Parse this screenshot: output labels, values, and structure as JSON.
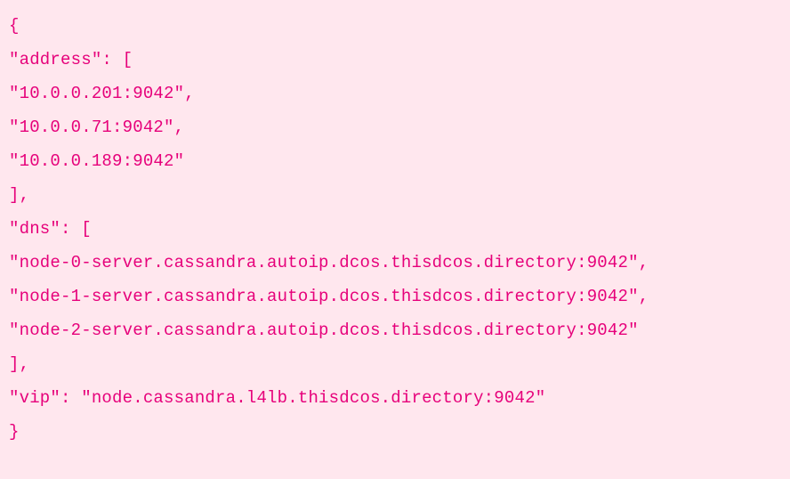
{
  "code": {
    "l01": "{",
    "l02": "\"address\": [",
    "l03": "\"10.0.0.201:9042\",",
    "l04": "\"10.0.0.71:9042\",",
    "l05": "\"10.0.0.189:9042\"",
    "l06": "],",
    "l07": "\"dns\": [",
    "l08": "\"node-0-server.cassandra.autoip.dcos.thisdcos.directory:9042\",",
    "l09": "\"node-1-server.cassandra.autoip.dcos.thisdcos.directory:9042\",",
    "l10": "\"node-2-server.cassandra.autoip.dcos.thisdcos.directory:9042\"",
    "l11": "],",
    "l12": "\"vip\": \"node.cassandra.l4lb.thisdcos.directory:9042\"",
    "l13": "}"
  }
}
